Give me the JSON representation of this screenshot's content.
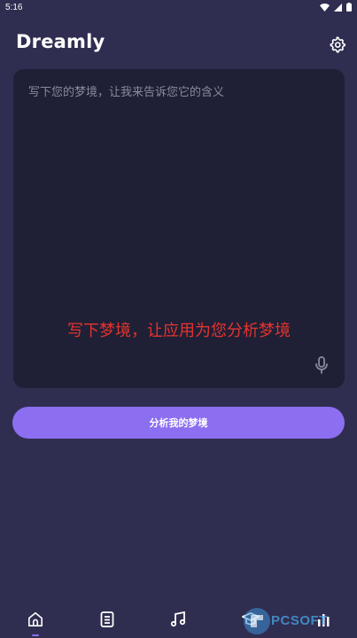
{
  "status_bar": {
    "time": "5:16"
  },
  "header": {
    "title": "Dreamly"
  },
  "dream_input": {
    "placeholder": "写下您的梦境，让我来告诉您它的含义"
  },
  "overlay_caption": "写下梦境，让应用为您分析梦境",
  "analyze_button": {
    "label": "分析我的梦境"
  },
  "bottom_nav": {
    "items": [
      {
        "icon": "home-icon",
        "active": true
      },
      {
        "icon": "document-icon",
        "active": false
      },
      {
        "icon": "music-icon",
        "active": false
      },
      {
        "icon": "graduation-cap-icon",
        "active": false
      },
      {
        "icon": "bar-chart-icon",
        "active": false
      }
    ]
  },
  "watermark": {
    "text": "PCSOFT"
  },
  "colors": {
    "background": "#2f2d50",
    "input_background": "#1f2036",
    "accent": "#8c6ef0",
    "caption": "#e5332f"
  }
}
